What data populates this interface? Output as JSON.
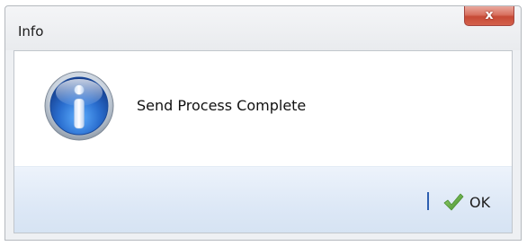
{
  "window": {
    "title": "Info",
    "close_label": "x"
  },
  "dialog": {
    "icon": "info-icon",
    "message": "Send Process Complete"
  },
  "footer": {
    "ok_icon": "checkmark-icon",
    "ok_label": "OK"
  },
  "colors": {
    "close_button": "#d4614c",
    "footer_background": "#dde8f6",
    "info_icon_blue": "#2a6ecf",
    "checkmark_green": "#5aa83c",
    "separator": "#2d5fb0"
  }
}
